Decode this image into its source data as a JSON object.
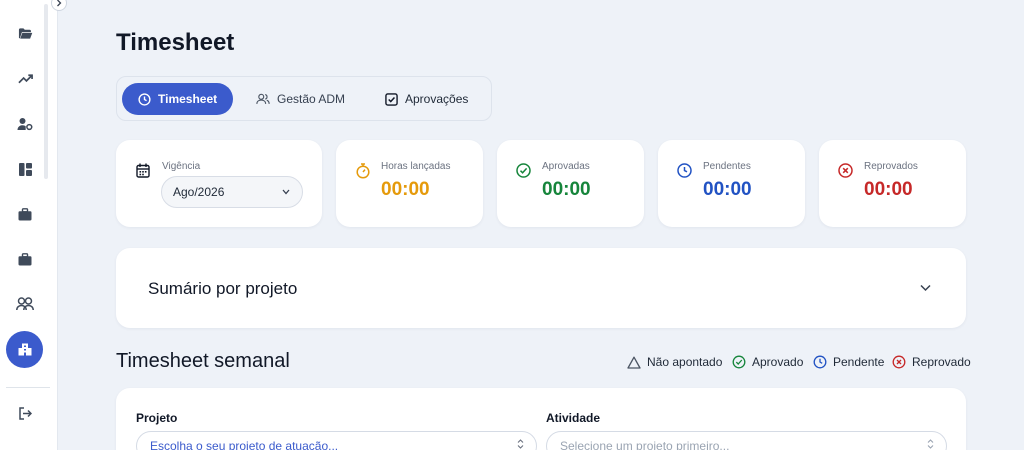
{
  "page": {
    "title": "Timesheet"
  },
  "tabs": [
    {
      "label": "Timesheet",
      "icon": "clock-icon",
      "active": true
    },
    {
      "label": "Gestão ADM",
      "icon": "users-icon",
      "active": false
    },
    {
      "label": "Aprovações",
      "icon": "check-square-icon",
      "active": false
    }
  ],
  "vigencia": {
    "label": "Vigência",
    "value": "Ago/2026"
  },
  "stats": {
    "horas": {
      "label": "Horas lançadas",
      "value": "00:00",
      "color": "#e59a0b"
    },
    "aprovadas": {
      "label": "Aprovadas",
      "value": "00:00",
      "color": "#16853b"
    },
    "pendentes": {
      "label": "Pendentes",
      "value": "00:00",
      "color": "#2152c3"
    },
    "reprovados": {
      "label": "Reprovados",
      "value": "00:00",
      "color": "#c62828"
    }
  },
  "summary": {
    "title": "Sumário por projeto"
  },
  "weekly": {
    "title": "Timesheet semanal",
    "legend": [
      {
        "label": "Não apontado",
        "icon": "triangle-icon"
      },
      {
        "label": "Aprovado",
        "icon": "check-circle-icon"
      },
      {
        "label": "Pendente",
        "icon": "clock-icon"
      },
      {
        "label": "Reprovado",
        "icon": "x-circle-icon"
      }
    ]
  },
  "form": {
    "projeto_label": "Projeto",
    "projeto_placeholder": "Escolha o seu projeto de atuação...",
    "atividade_label": "Atividade",
    "atividade_placeholder": "Selecione um projeto primeiro..."
  },
  "colors": {
    "accent": "#3b5bcc",
    "background": "#eef2f8"
  }
}
